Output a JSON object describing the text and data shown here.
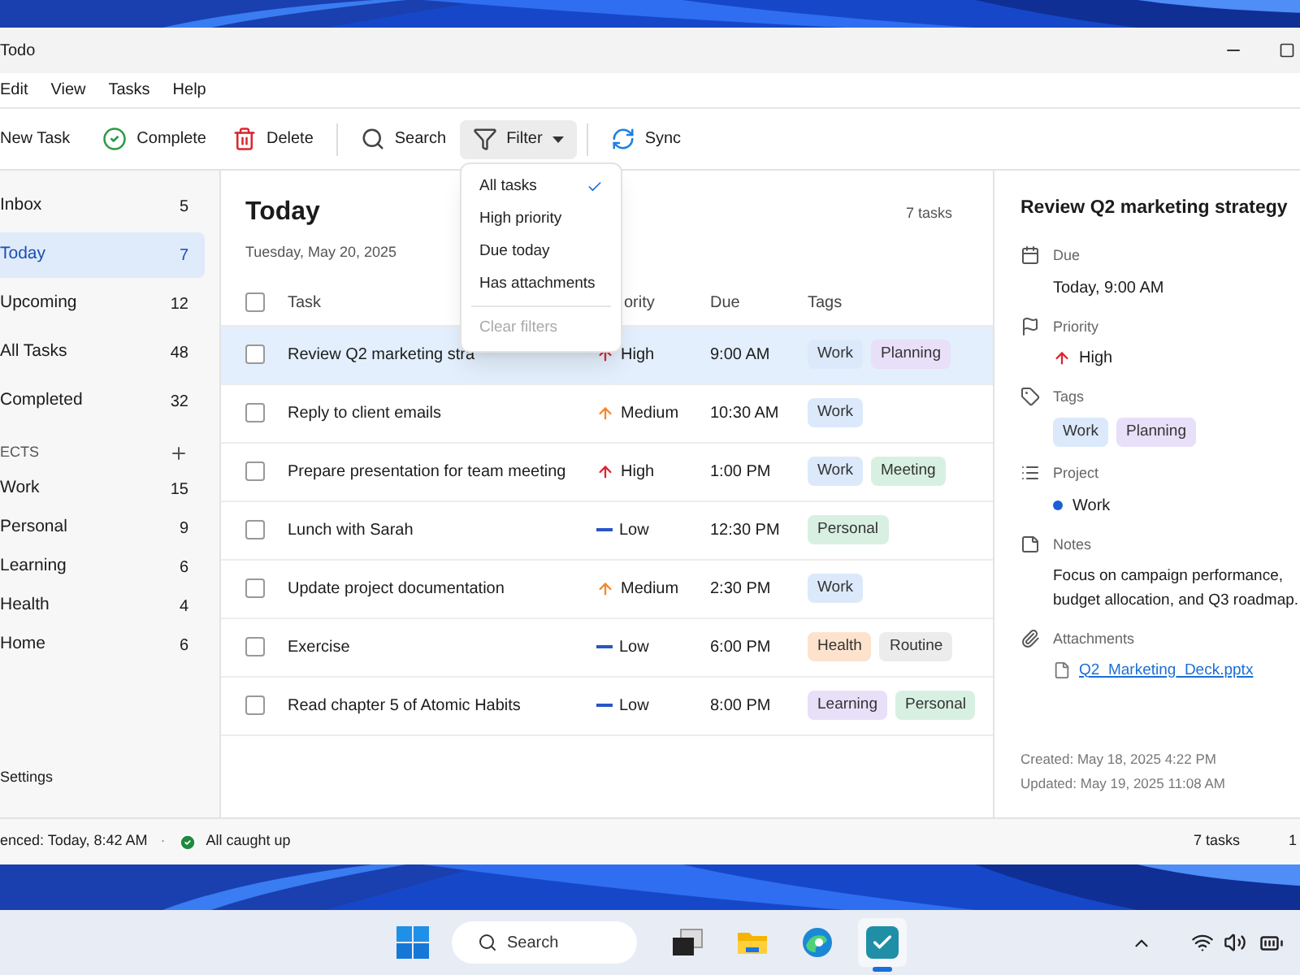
{
  "window": {
    "title": "Todo"
  },
  "menu": [
    "Edit",
    "View",
    "Tasks",
    "Help"
  ],
  "toolbar": [
    {
      "kind": "new",
      "label": "New Task"
    },
    {
      "kind": "complete",
      "label": "Complete"
    },
    {
      "kind": "delete",
      "label": "Delete"
    },
    {
      "kind": "search",
      "label": "Search"
    },
    {
      "kind": "filter",
      "label": "Filter",
      "expanded": true
    },
    {
      "kind": "sync",
      "label": "Sync"
    }
  ],
  "filter_menu": [
    {
      "label": "All tasks",
      "selected": true,
      "disabled": false
    },
    {
      "label": "High priority",
      "selected": false,
      "disabled": false
    },
    {
      "label": "Due today",
      "selected": false,
      "disabled": false
    },
    {
      "label": "Has attachments",
      "selected": false,
      "disabled": false
    },
    {
      "label": "Clear filters",
      "selected": false,
      "disabled": true
    }
  ],
  "sidebar": {
    "items": [
      {
        "label": "Inbox",
        "count": "5",
        "selected": false
      },
      {
        "label": "Today",
        "count": "7",
        "selected": true
      },
      {
        "label": "Upcoming",
        "count": "12",
        "selected": false
      },
      {
        "label": "All Tasks",
        "count": "48",
        "selected": false
      },
      {
        "label": "Completed",
        "count": "32",
        "selected": false
      }
    ],
    "section_title": "ECTS",
    "projects": [
      {
        "label": "Work",
        "count": "15"
      },
      {
        "label": "Personal",
        "count": "9"
      },
      {
        "label": "Learning",
        "count": "6"
      },
      {
        "label": "Health",
        "count": "4"
      },
      {
        "label": "Home",
        "count": "6"
      }
    ],
    "settings": "Settings"
  },
  "main": {
    "title": "Today",
    "date": "Tuesday, May 20, 2025",
    "count": "7 tasks",
    "select_all": {
      "checked": false
    },
    "columns": [
      "Task",
      "ority",
      "Due",
      "Tags"
    ],
    "rows": [
      {
        "task": "Review Q2 marketing stra",
        "priority": {
          "label": "High",
          "kind": "high"
        },
        "due": "9:00 AM",
        "checked": false,
        "selected": true,
        "tags": [
          {
            "label": "Work",
            "color": "#dbe9fb"
          },
          {
            "label": "Planning",
            "color": "#e8dff8"
          }
        ]
      },
      {
        "task": "Reply to client emails",
        "priority": {
          "label": "Medium",
          "kind": "medium"
        },
        "due": "10:30 AM",
        "checked": false,
        "selected": false,
        "tags": [
          {
            "label": "Work",
            "color": "#dbe9fb"
          }
        ]
      },
      {
        "task": "Prepare presentation for team meeting",
        "priority": {
          "label": "High",
          "kind": "high"
        },
        "due": "1:00 PM",
        "checked": false,
        "selected": false,
        "tags": [
          {
            "label": "Work",
            "color": "#dbe9fb"
          },
          {
            "label": "Meeting",
            "color": "#d8f0e2"
          }
        ]
      },
      {
        "task": "Lunch with Sarah",
        "priority": {
          "label": "Low",
          "kind": "low"
        },
        "due": "12:30 PM",
        "checked": false,
        "selected": false,
        "tags": [
          {
            "label": "Personal",
            "color": "#d8f0e2"
          }
        ]
      },
      {
        "task": "Update project documentation",
        "priority": {
          "label": "Medium",
          "kind": "medium"
        },
        "due": "2:30 PM",
        "checked": false,
        "selected": false,
        "tags": [
          {
            "label": "Work",
            "color": "#dbe9fb"
          }
        ]
      },
      {
        "task": "Exercise",
        "priority": {
          "label": "Low",
          "kind": "low"
        },
        "due": "6:00 PM",
        "checked": false,
        "selected": false,
        "tags": [
          {
            "label": "Health",
            "color": "#fde3cd"
          },
          {
            "label": "Routine",
            "color": "#ececec"
          }
        ]
      },
      {
        "task": "Read chapter 5 of Atomic Habits",
        "priority": {
          "label": "Low",
          "kind": "low"
        },
        "due": "8:00 PM",
        "checked": false,
        "selected": false,
        "tags": [
          {
            "label": "Learning",
            "color": "#e8dff8"
          },
          {
            "label": "Personal",
            "color": "#d8f0e2"
          }
        ]
      }
    ]
  },
  "detail": {
    "title": "Review Q2 marketing strategy",
    "due_label": "Due",
    "due": "Today, 9:00 AM",
    "priority_label": "Priority",
    "priority": {
      "label": "High",
      "kind": "high"
    },
    "tags_label": "Tags",
    "tags": [
      {
        "label": "Work",
        "color": "#dbe9fb"
      },
      {
        "label": "Planning",
        "color": "#e8dff8"
      }
    ],
    "project_label": "Project",
    "project": {
      "label": "Work",
      "color": "#1a5fd6"
    },
    "notes_label": "Notes",
    "notes": "Focus on campaign performance, budget allocation, and Q3 roadmap.",
    "attachments_label": "Attachments",
    "attachment": "Q2_Marketing_Deck.pptx",
    "created": "Created: May 18, 2025 4:22 PM",
    "updated": "Updated: May 19, 2025 11:08 AM"
  },
  "status_bar": {
    "synced": "enced: Today, 8:42 AM",
    "separator": "·",
    "state": "All caught up",
    "count": "7 tasks",
    "extra": "1"
  },
  "taskbar": {
    "search": "Search",
    "apps": [
      {
        "kind": "taskview",
        "selected": false
      },
      {
        "kind": "folder",
        "selected": false
      },
      {
        "kind": "browser",
        "selected": false
      },
      {
        "kind": "todo",
        "selected": true
      }
    ]
  }
}
